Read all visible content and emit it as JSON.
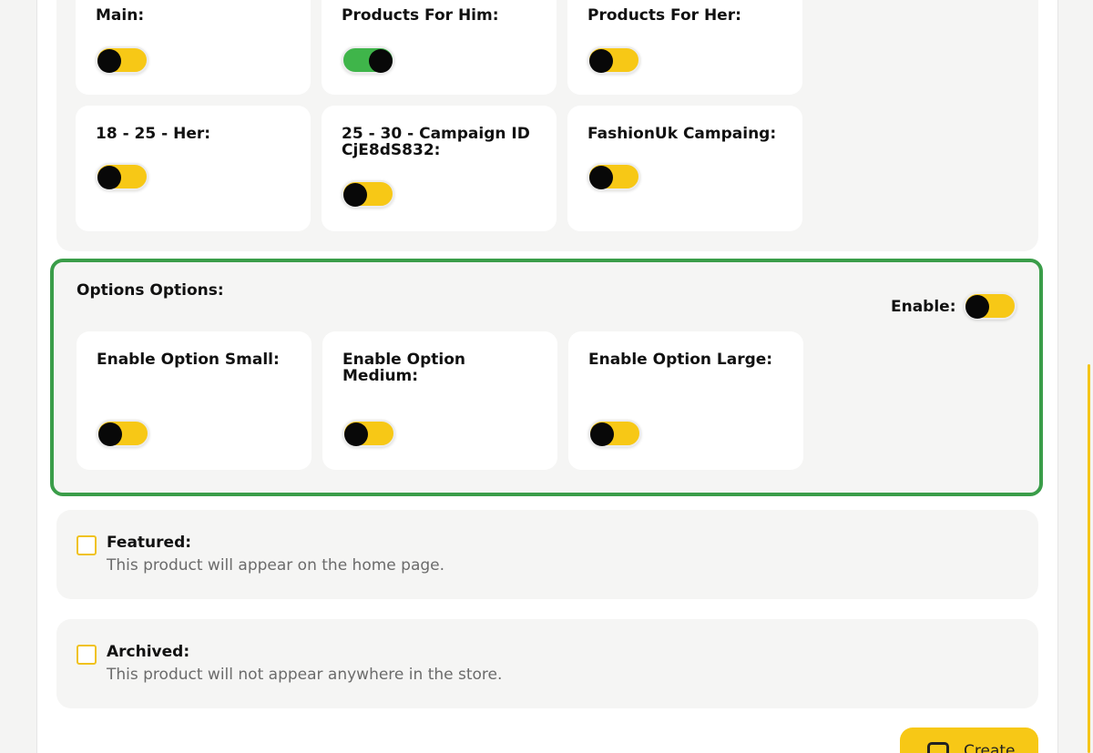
{
  "collections": {
    "items": [
      {
        "label": "Main:",
        "state": "off"
      },
      {
        "label": "Products For Him:",
        "state": "on"
      },
      {
        "label": "Products For Her:",
        "state": "off"
      },
      {
        "label": "18 - 25 - Her:",
        "state": "off"
      },
      {
        "label": "25 - 30 - Campaign ID CjE8dS832:",
        "state": "off"
      },
      {
        "label": "FashionUk Campaing:",
        "state": "off"
      }
    ]
  },
  "options": {
    "title": "Options Options:",
    "enable_label": "Enable:",
    "enable_state": "off",
    "items": [
      {
        "label": "Enable Option Small:",
        "state": "off"
      },
      {
        "label": "Enable Option Medium:",
        "state": "off"
      },
      {
        "label": "Enable Option Large:",
        "state": "off"
      }
    ]
  },
  "featured": {
    "title": "Featured:",
    "description": "This product will appear on the home page.",
    "checked": false
  },
  "archived": {
    "title": "Archived:",
    "description": "This product will not appear anywhere in the store.",
    "checked": false
  },
  "actions": {
    "create_label": "Create",
    "create_icon": "save-icon"
  },
  "colors": {
    "accent": "#f7c816",
    "toggle_on": "#3fb54a",
    "highlight_border": "#3a9d49"
  }
}
